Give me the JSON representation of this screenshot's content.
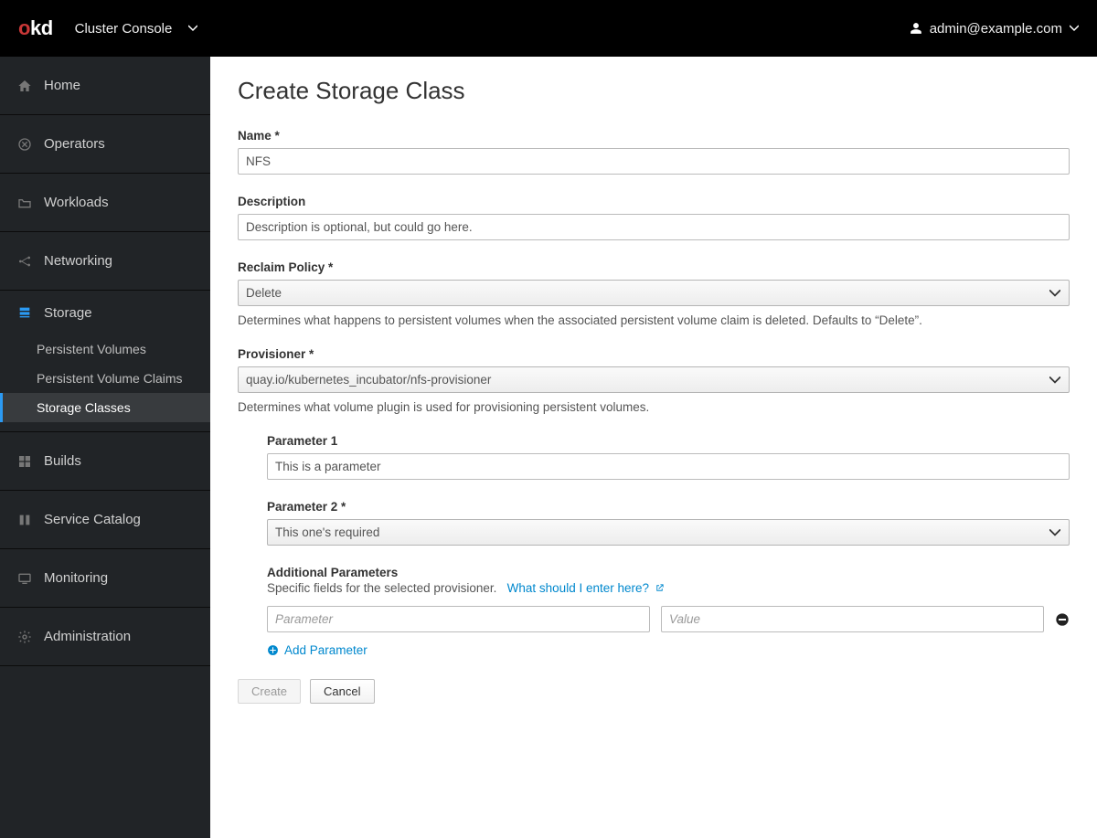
{
  "header": {
    "logo_o": "o",
    "logo_kd": "kd",
    "console_label": "Cluster Console",
    "user": "admin@example.com"
  },
  "sidebar": {
    "items": [
      {
        "label": "Home"
      },
      {
        "label": "Operators"
      },
      {
        "label": "Workloads"
      },
      {
        "label": "Networking"
      },
      {
        "label": "Storage",
        "expanded": true,
        "children": [
          {
            "label": "Persistent Volumes"
          },
          {
            "label": "Persistent Volume Claims"
          },
          {
            "label": "Storage Classes",
            "active": true
          }
        ]
      },
      {
        "label": "Builds"
      },
      {
        "label": "Service Catalog"
      },
      {
        "label": "Monitoring"
      },
      {
        "label": "Administration"
      }
    ]
  },
  "page": {
    "title": "Create Storage Class",
    "name_label": "Name *",
    "name_value": "NFS",
    "description_label": "Description",
    "description_value": "Description is optional, but could go here.",
    "reclaim_label": "Reclaim Policy *",
    "reclaim_value": "Delete",
    "reclaim_help": "Determines what happens to persistent volumes when the associated persistent volume claim is deleted. Defaults to “Delete”.",
    "provisioner_label": "Provisioner *",
    "provisioner_value": "quay.io/kubernetes_incubator/nfs-provisioner",
    "provisioner_help": "Determines what volume plugin is used for provisioning persistent volumes.",
    "param1_label": "Parameter 1",
    "param1_value": "This is a parameter",
    "param2_label": "Parameter 2 *",
    "param2_value": "This one's required",
    "addl_params_label": "Additional Parameters",
    "addl_params_desc": "Specific fields for the selected provisioner.",
    "addl_params_link": "What should I enter here?",
    "kv_key_placeholder": "Parameter",
    "kv_val_placeholder": "Value",
    "add_param_label": "Add Parameter",
    "create_label": "Create",
    "cancel_label": "Cancel"
  }
}
